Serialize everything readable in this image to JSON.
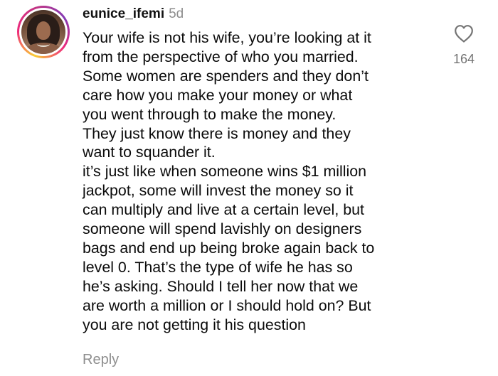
{
  "comment": {
    "username": "eunice_ifemi",
    "timestamp": "5d",
    "text_lines": [
      "Your wife is not his wife, you’re looking at it",
      "from the perspective of who you married.",
      "Some women are spenders and they don’t",
      "care how you make your money or what",
      "you went through to make the money.",
      "They just know there is money and they",
      "want to squander it.",
      "it’s just like when someone wins $1 million",
      "jackpot, some will invest the money so it",
      "can multiply and live at a certain level, but",
      "someone will spend lavishly on designers",
      "bags and end up being broke again back to",
      "level 0. That’s the type of wife he has so",
      "he’s asking. Should I tell her now that we",
      "are worth a million or I should hold on? But",
      "you are not getting it his question"
    ],
    "like_count": "164",
    "reply_label": "Reply",
    "avatar_icon": "profile-photo",
    "like_icon": "heart-outline-icon"
  },
  "colors": {
    "text": "#0b0b0b",
    "secondary": "#8e8e8e",
    "like_count": "#737373",
    "story_ring": [
      "#f9ce34",
      "#ee2a7b",
      "#833ab4"
    ]
  }
}
